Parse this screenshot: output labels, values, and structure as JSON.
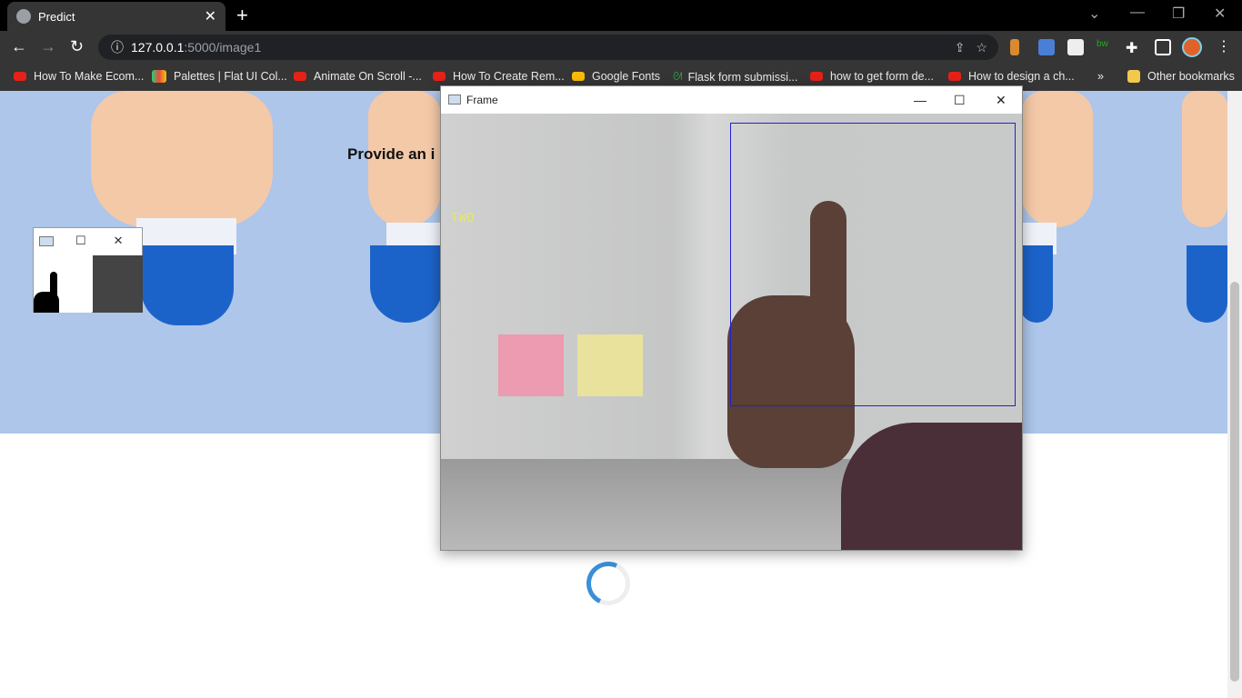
{
  "browser": {
    "tab_title": "Predict",
    "url_host": "127.0.0.1",
    "url_path": ":5000/image1",
    "bookmarks": [
      "How To Make Ecom...",
      "Palettes | Flat UI Col...",
      "Animate On Scroll -...",
      "How To Create Rem...",
      "Google Fonts",
      "Flask form submissi...",
      "how to get form de...",
      "How to design a ch..."
    ],
    "other_bookmarks": "Other bookmarks",
    "more": "»"
  },
  "page": {
    "heading": "Provide an i"
  },
  "frame_window": {
    "title": "Frame",
    "prediction": "TWO"
  },
  "colors": {
    "hero": "#adc6ea",
    "roi": "#2222cc",
    "spinner": "#3a8fd8"
  }
}
